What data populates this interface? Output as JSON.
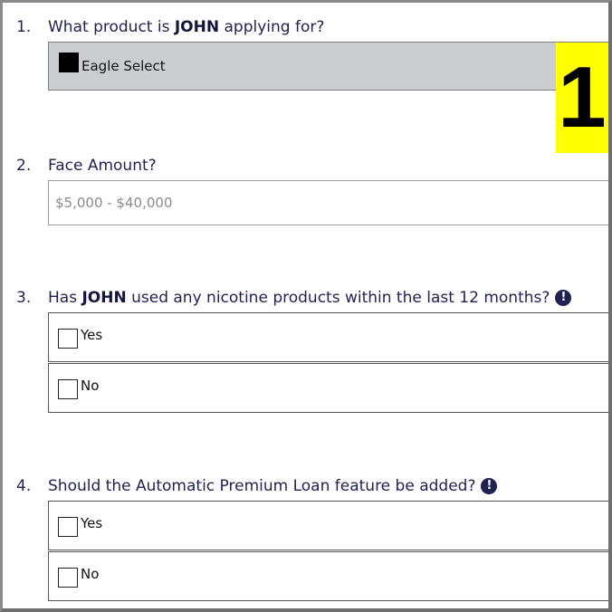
{
  "questions": [
    {
      "number": "1.",
      "text_before": "What product is ",
      "name": "JOHN",
      "text_after": " applying for?",
      "selected_value": "Eagle Select"
    },
    {
      "number": "2.",
      "text": "Face Amount?",
      "placeholder": "$5,000 - $40,000"
    },
    {
      "number": "3.",
      "text_before": "Has ",
      "name": "JOHN",
      "text_after": " used any nicotine products within the last 12 months?",
      "info_icon": "!",
      "options": [
        "Yes",
        "No"
      ]
    },
    {
      "number": "4.",
      "text": "Should the Automatic Premium Loan feature be added?",
      "info_icon": "!",
      "options": [
        "Yes",
        "No"
      ]
    }
  ],
  "badge": {
    "label": "1",
    "color": "#ffff00"
  },
  "colors": {
    "question_text": "#1f2250",
    "select_bg": "#cccdd1"
  }
}
